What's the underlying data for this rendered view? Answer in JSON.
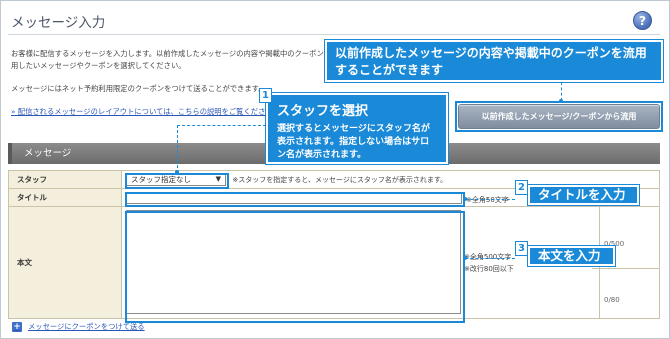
{
  "page": {
    "title": "メッセージ入力",
    "help_label": "?",
    "intro_text": "お客様に配信するメッセージを入力します。以前作成したメッセージの内容や掲載中のクーポンを流用したいメッセージやクーポンを選択してください。",
    "intro_text_2": "メッセージにはネット予約利用限定のクーポンをつけて送ることができます。",
    "layout_link": "» 配信されるメッセージのレイアウトについては、こちらの説明をご覧ください",
    "reuse_button": "以前作成したメッセージ/クーポンから流用"
  },
  "section": {
    "title": "メッセージ"
  },
  "form": {
    "staff_label": "スタッフ",
    "staff_select_value": "スタッフ指定なし",
    "staff_note": "※スタッフを指定すると、メッセージにスタッフ名が表示されます。",
    "title_label": "タイトル",
    "title_value": "",
    "title_note": "※全角50文字",
    "body_label": "本文",
    "body_value": "",
    "body_note_1": "※全角500文字",
    "body_note_2": "※改行80回以下",
    "counter_chars": "0/500",
    "counter_lines": "0/80"
  },
  "coupon_link": {
    "icon": "plus-icon",
    "label": "メッセージにクーポンをつけて送る"
  },
  "callouts": {
    "reuse": "以前作成したメッセージの内容や掲載中のクーポンを流用することができます",
    "staff_number": "1",
    "staff_title": "スタッフを選択",
    "staff_desc": "選択するとメッセージにスタッフ名が表示されます。指定しない場合はサロン名が表示されます。",
    "title_number": "2",
    "title_text": "タイトルを入力",
    "body_number": "3",
    "body_text": "本文を入力"
  },
  "colors": {
    "callout_blue": "#1a8ad8",
    "section_gray": "#7a7a7a",
    "label_bg": "#f3efdc",
    "link_blue": "#2a56b8"
  }
}
